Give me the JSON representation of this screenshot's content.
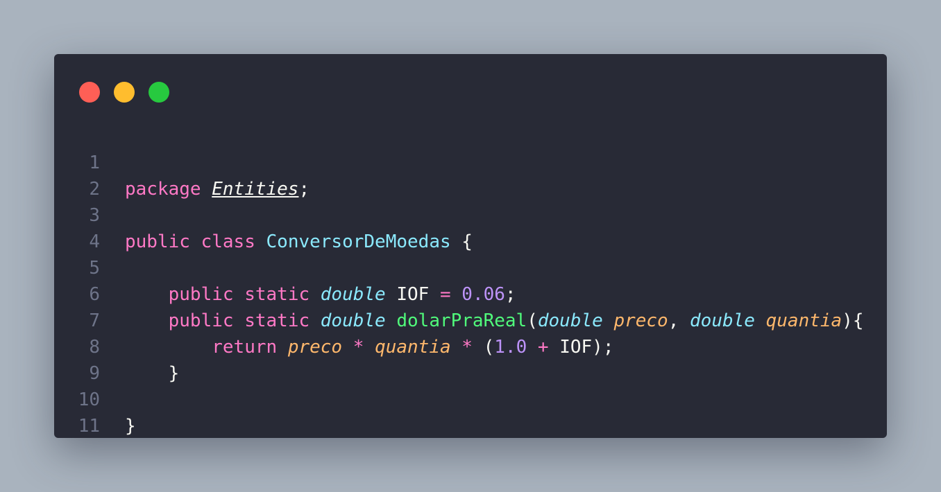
{
  "window": {
    "controls": [
      {
        "name": "close",
        "color": "#ff5f56"
      },
      {
        "name": "minimize",
        "color": "#ffbd2e"
      },
      {
        "name": "maximize",
        "color": "#27c93f"
      }
    ]
  },
  "colors": {
    "background": "#a9b3be",
    "editor": "#282a36",
    "keyword": "#ff79c6",
    "class_name": "#8be9fd",
    "type": "#8be9fd",
    "function": "#50fa7b",
    "parameter": "#ffb86c",
    "number": "#bd93f9",
    "text": "#f8f8f2",
    "line_number": "#6e7489"
  },
  "code": {
    "line_numbers": [
      "1",
      "2",
      "3",
      "4",
      "5",
      "6",
      "7",
      "8",
      "9",
      "10",
      "11"
    ],
    "l1": {
      "kw": "package",
      "pkg": "Entities",
      "semi": ";"
    },
    "l3": {
      "kw_public": "public",
      "kw_class": "class",
      "name": "ConversorDeMoedas",
      "brace": "{"
    },
    "l5": {
      "kw_public": "public",
      "kw_static": "static",
      "type": "double",
      "ident": "IOF",
      "eq": "=",
      "num": "0.06",
      "semi": ";"
    },
    "l6": {
      "kw_public": "public",
      "kw_static": "static",
      "type": "double",
      "fn": "dolarPraReal",
      "open": "(",
      "type1": "double",
      "p1": "preco",
      "comma": ",",
      "type2": "double",
      "p2": "quantia",
      "close": "){"
    },
    "l7": {
      "kw_return": "return",
      "p1": "preco",
      "op1": "*",
      "p2": "quantia",
      "op2": "*",
      "open": "(",
      "num": "1.0",
      "op3": "+",
      "ident": "IOF",
      "close": ");"
    },
    "l8": {
      "brace": "}"
    },
    "l10": {
      "brace": "}"
    }
  }
}
